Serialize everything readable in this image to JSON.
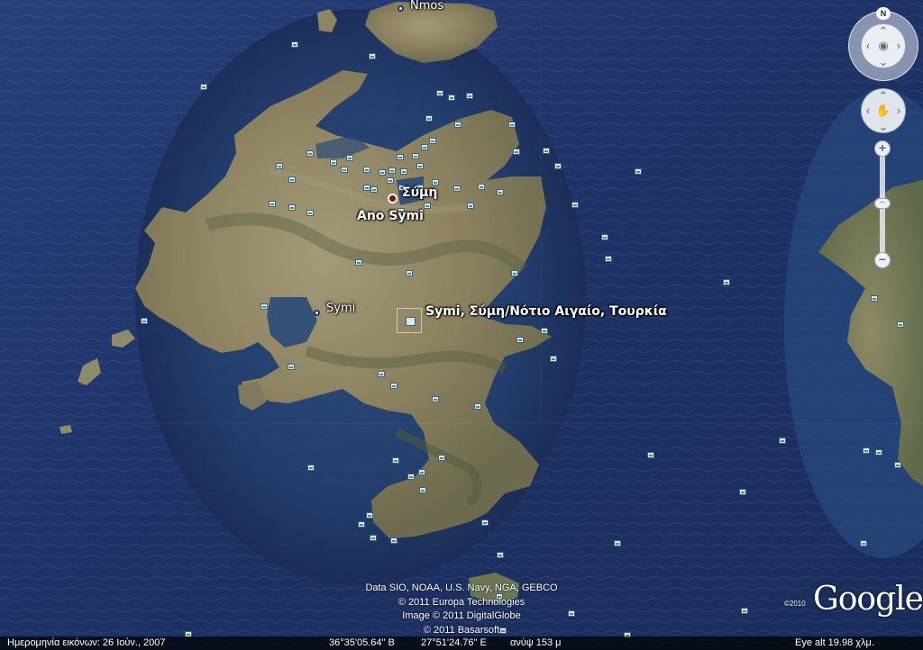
{
  "labels": {
    "nimos": "Nmos",
    "symi_town_greek": "Σύμη",
    "ano_symi": "Ano Symi",
    "symi_west": "Symi",
    "search_result": "Symi, Σύμη/Νότιο Αιγαίο, Τουρκία"
  },
  "attribution": [
    "Data SIO, NOAA, U.S. Navy, NGA, GEBCO",
    "© 2011 Europa Technologies",
    "Image © 2011 DigitalGlobe",
    "© 2011 Basarsoft"
  ],
  "copyright_year": "©2010",
  "logo": "Google",
  "status": {
    "imagery_date": "Ημερομηνία εικόνων: 26 Ιούν., 2007",
    "latitude": "36°35'05.64\" Β",
    "longitude": "27°51'24.76\" Ε",
    "elevation": "ανύψ  153 μ",
    "eye_alt": "Eye alt   19.98 χλμ."
  },
  "nav": {
    "north": "N",
    "look_icon": "eye-icon",
    "move_icon": "hand-icon",
    "zoom_in": "+",
    "zoom_out": "−"
  },
  "colors": {
    "sea": "#22345f",
    "land": "#8f8560",
    "status_bar": "#000000"
  }
}
